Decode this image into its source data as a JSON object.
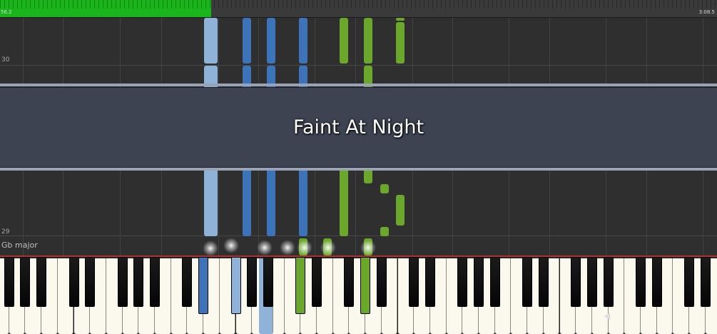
{
  "progress": {
    "elapsed_label": "56.2",
    "total_label": "3:08.5",
    "played_fraction": 0.295,
    "fill_color": "#1ab51a"
  },
  "roll": {
    "measure_labels": [
      "30",
      "29"
    ],
    "key_signature": "Gb major"
  },
  "banner": {
    "song_title": "Faint At Night"
  },
  "colors": {
    "left_hand_light": "#8fb2d8",
    "left_hand": "#3d73b8",
    "right_hand": "#6aa72a"
  },
  "icons": [
    "mouse-cursor-icon"
  ]
}
